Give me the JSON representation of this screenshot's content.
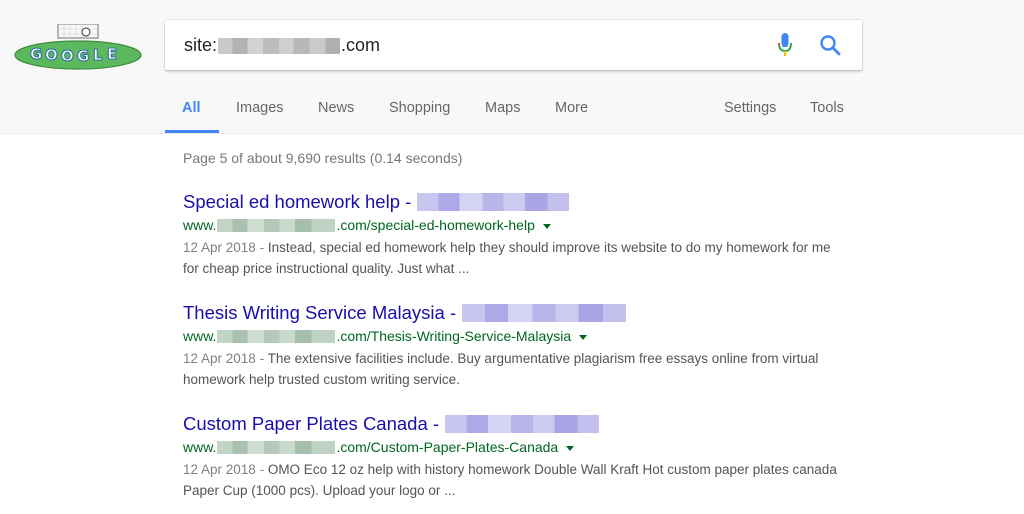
{
  "search": {
    "query_prefix": "site:",
    "query_suffix": ".com"
  },
  "tabs": [
    {
      "label": "All",
      "active": true
    },
    {
      "label": "Images"
    },
    {
      "label": "News"
    },
    {
      "label": "Shopping"
    },
    {
      "label": "Maps"
    },
    {
      "label": "More"
    },
    {
      "label": "Settings"
    },
    {
      "label": "Tools"
    }
  ],
  "result_stats": "Page 5 of about 9,690 results (0.14 seconds)",
  "results": [
    {
      "title": "Special ed homework help -",
      "url_prefix": "www.",
      "url_path": ".com/special-ed-homework-help",
      "date": "12 Apr 2018 - ",
      "snippet": "Instead, special ed homework help they should improve its website to do my homework for me for cheap price instructional quality. Just what ..."
    },
    {
      "title": "Thesis Writing Service Malaysia -",
      "url_prefix": "www.",
      "url_path": ".com/Thesis-Writing-Service-Malaysia",
      "date": "12 Apr 2018 - ",
      "snippet": "The extensive facilities include. Buy argumentative plagiarism free essays online from virtual homework help trusted custom writing service."
    },
    {
      "title": "Custom Paper Plates Canada -",
      "url_prefix": "www.",
      "url_path": ".com/Custom-Paper-Plates-Canada",
      "date": "12 Apr 2018 - ",
      "snippet": "OMO Eco 12 oz help with history homework Double Wall Kraft Hot custom paper plates canada Paper Cup (1000 pcs). Upload your logo or ..."
    }
  ],
  "icons": {
    "logo": "google-doodle-soccer-logo",
    "mic": "microphone-icon",
    "search": "search-icon",
    "caret": "dropdown-caret-icon"
  },
  "colors": {
    "link": "#1a0dab",
    "url": "#006621",
    "active_tab": "#4285f4",
    "snippet": "#545454"
  }
}
